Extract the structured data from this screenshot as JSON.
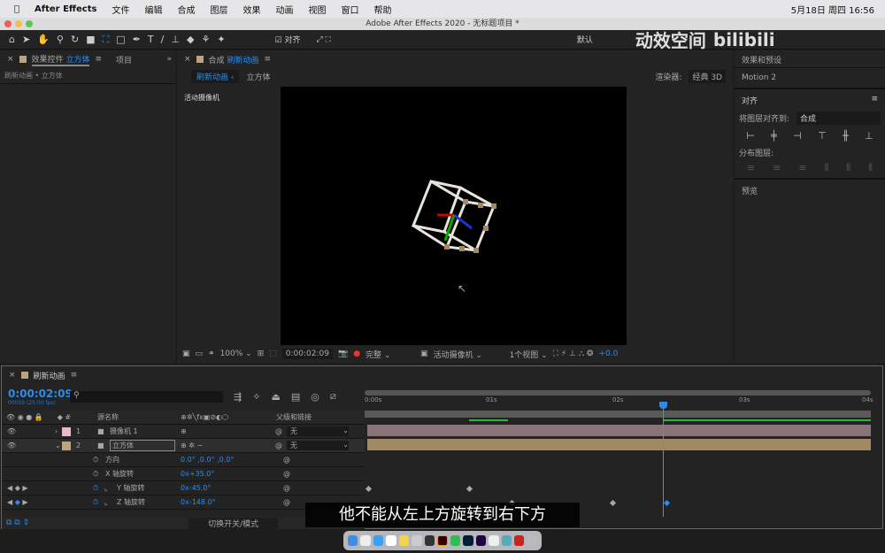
{
  "menubar": {
    "app": "After Effects",
    "items": [
      "文件",
      "编辑",
      "合成",
      "图层",
      "效果",
      "动画",
      "视图",
      "窗口",
      "帮助"
    ],
    "clock": "5月18日 周四  16:56"
  },
  "window": {
    "title": "Adobe After Effects 2020 - 无标题项目 *"
  },
  "toolbar": {
    "snap_label": "对齐",
    "workspace": "默认",
    "watermark": "动效空间",
    "watermark_logo": "bilibili"
  },
  "effects_panel": {
    "tab_prefix": "效果控件",
    "tab_layer": "立方体",
    "tab_project": "项目",
    "breadcrumb": "刷新动画 • 立方体"
  },
  "comp_panel": {
    "tab_prefix": "合成",
    "tab_comp": "刷新动画",
    "crumb_active": "刷新动画",
    "crumb_layer": "立方体",
    "renderer_label": "渲染器:",
    "renderer": "经典 3D",
    "camera_label": "活动摄像机",
    "footer": {
      "zoom": "100%",
      "timecode": "0:00:02:09",
      "quality": "完整",
      "view": "活动摄像机",
      "views": "1个视图",
      "exposure": "+0.0"
    }
  },
  "right_panel": {
    "effects_presets": "效果和预设",
    "motion": "Motion 2",
    "align_title": "对齐",
    "align_to_label": "将图层对齐到:",
    "align_to": "合成",
    "distribute_label": "分布图层:",
    "preview": "预览"
  },
  "timeline": {
    "tab": "刷新动画",
    "timecode": "0:00:02:09",
    "frames": "00059 (25.00 fps)",
    "col_name": "源名称",
    "col_parent": "父级和链接",
    "toggle_label": "切换开关/模式",
    "ruler": [
      "0:00s",
      "01s",
      "02s",
      "03s",
      "04s"
    ],
    "current_time_s": 2.36,
    "duration_s": 4,
    "layers": [
      {
        "num": "1",
        "name": "摄像机 1",
        "parent": "无",
        "color": "#e8b9c9",
        "bar": "#8a7378"
      },
      {
        "num": "2",
        "name": "立方体",
        "parent": "无",
        "color": "#bda47e",
        "bar": "#a08a66"
      }
    ],
    "props": [
      {
        "name": "方向",
        "value": "0.0° ,0.0° ,0.0°",
        "keys": []
      },
      {
        "name": "X 轴旋转",
        "value": "0x+35.0°",
        "keys": []
      },
      {
        "name": "Y 轴旋转",
        "value": "0x-45.0°",
        "keys": [
          0,
          0.8
        ]
      },
      {
        "name": "Z 轴旋转",
        "value": "0x-148.0°",
        "keys": [
          1.13,
          1.93,
          2.36
        ]
      }
    ]
  },
  "subtitle": "他不能从左上方旋转到右下方",
  "colors": {
    "accent": "#2d8ceb",
    "panel": "#232323",
    "viewer": "#000000"
  }
}
